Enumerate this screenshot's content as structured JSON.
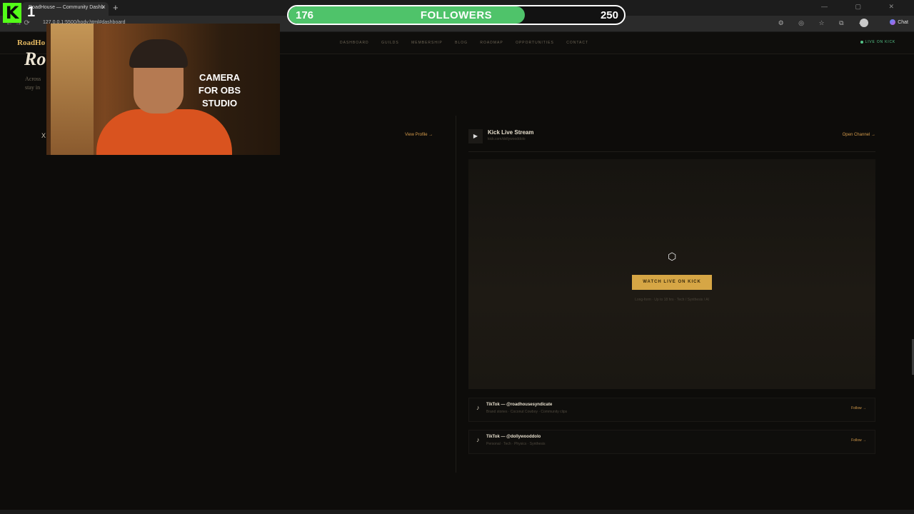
{
  "browser": {
    "tab_title": "RoadHouse — Community Dashb",
    "tab_close": "×",
    "new_tab": "+",
    "url": "127.0.0.1:5500/hody.html#dashboard",
    "nav_arrows": "← → ⟳",
    "ext_icons": "⚙ ◎ ☆ ⧉ ⋯",
    "chat_label": "Chat",
    "win_controls": "— ▢ ✕"
  },
  "overlay": {
    "kick_logo": "K",
    "kick_count": "1",
    "followers": {
      "current": "176",
      "label": "FOLLOWERS",
      "goal": "250",
      "progress": 0.704
    },
    "camera_text": "CAMERA FOR OBS STUDIO"
  },
  "site": {
    "brand": "RoadHo",
    "nav": [
      "DASHBOARD",
      "GUILDS",
      "MEMBERSHIP",
      "BLOG",
      "ROADMAP",
      "OPPORTUNITIES",
      "CONTACT"
    ],
    "live_on_kick": "LIVE ON KICK",
    "hero_title": "Ro",
    "hero_sub_1": "Across",
    "hero_sub_2": "stay in"
  },
  "left_panel": {
    "x_icon": "X",
    "view_profile": "View Profile →"
  },
  "kick_panel": {
    "title": "Kick Live Stream",
    "subtitle": "kick.com/dollywooddolo",
    "open_channel": "Open Channel →",
    "watch_button": "WATCH LIVE ON KICK",
    "note": "Long-form · Up to 18 hrs · Tech / Synthesis / AI"
  },
  "tiktok": [
    {
      "title": "TikTok — @roadhousesyndicate",
      "sub": "Brand stories · Coconut Cowboy · Community clips",
      "follow": "Follow →"
    },
    {
      "title": "TikTok — @dollywooddolo",
      "sub": "Personal · Tech · Physics · Synthesis",
      "follow": "Follow →"
    }
  ]
}
